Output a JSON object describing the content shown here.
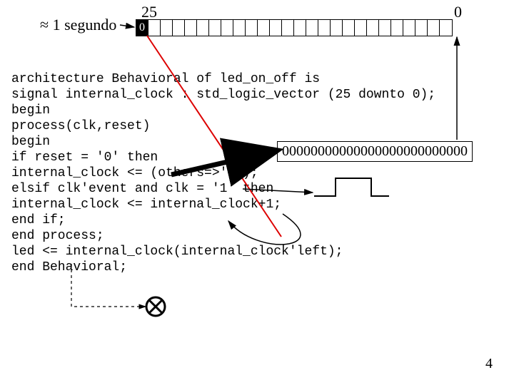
{
  "labels": {
    "segundo": "≈ 1 segundo",
    "bit_msb_index": "25",
    "bit_lsb_index": "0",
    "msb_cell": "0",
    "zeros_box": "00000000000000000000000000",
    "page_number": "4"
  },
  "bit_count": 26,
  "code_lines": [
    "architecture Behavioral of led_on_off is",
    "signal internal_clock : std_logic_vector (25 downto 0);",
    "begin",
    "process(clk,reset)",
    "begin",
    "if reset = '0' then",
    "internal_clock <= (others=>'0');",
    "elsif clk'event and clk = '1' then",
    "internal_clock <= internal_clock+1;",
    "end if;",
    "end process;",
    "led <= internal_clock(internal_clock'left);",
    "end Behavioral;"
  ]
}
